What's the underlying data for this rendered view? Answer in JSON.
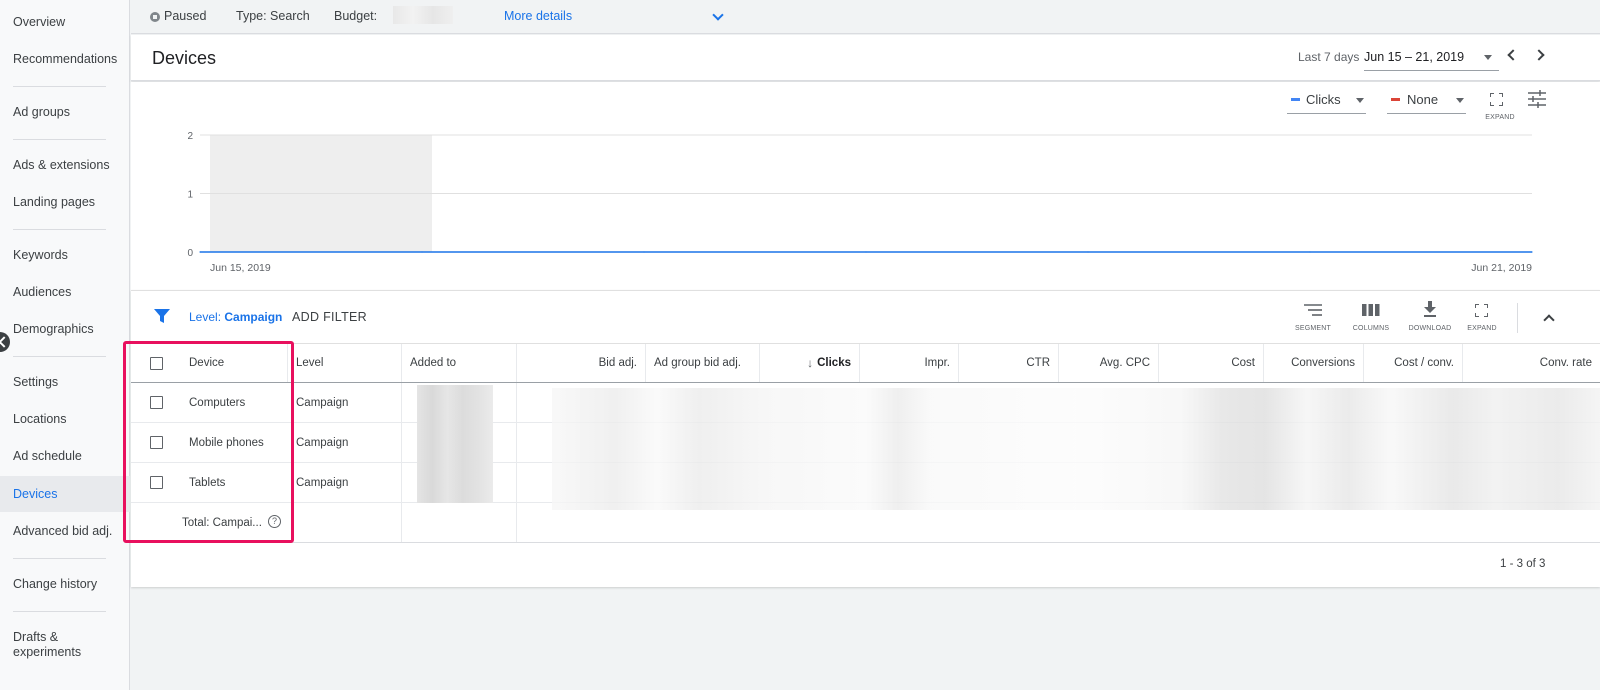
{
  "sidebar": {
    "items": [
      {
        "label": "Overview"
      },
      {
        "label": "Recommendations"
      },
      {
        "label": "Ad groups"
      },
      {
        "label": "Ads & extensions"
      },
      {
        "label": "Landing pages"
      },
      {
        "label": "Keywords"
      },
      {
        "label": "Audiences"
      },
      {
        "label": "Demographics"
      },
      {
        "label": "Settings"
      },
      {
        "label": "Locations"
      },
      {
        "label": "Ad schedule"
      },
      {
        "label": "Devices"
      },
      {
        "label": "Advanced bid adj."
      },
      {
        "label": "Change history"
      },
      {
        "label": "Drafts & experiments"
      }
    ],
    "active": "Devices"
  },
  "topbar": {
    "status": "Paused",
    "type": "Type: Search",
    "budget_label": "Budget:",
    "more_details": "More details"
  },
  "header": {
    "title": "Devices",
    "date_range_label": "Last 7 days",
    "date_range": "Jun 15 – 21, 2019"
  },
  "chart_controls": {
    "metric1": {
      "label": "Clicks",
      "color": "#4285f4"
    },
    "metric2": {
      "label": "None",
      "color": "#db4437"
    },
    "expand_label": "EXPAND"
  },
  "chart_data": {
    "type": "line",
    "x": [
      "Jun 15, 2019",
      "Jun 16, 2019",
      "Jun 17, 2019",
      "Jun 18, 2019",
      "Jun 19, 2019",
      "Jun 20, 2019",
      "Jun 21, 2019"
    ],
    "series": [
      {
        "name": "Clicks",
        "values": [
          0,
          0,
          0,
          0,
          0,
          0,
          0
        ],
        "color": "#1a73e8"
      }
    ],
    "ylim": [
      0,
      2
    ],
    "yticks": [
      0,
      1,
      2
    ],
    "xtick_labels": [
      "Jun 15, 2019",
      "Jun 21, 2019"
    ],
    "grid": true
  },
  "table_toolbar": {
    "level_prefix": "Level:",
    "level_value": "Campaign",
    "add_filter": "ADD FILTER",
    "tools": [
      "SEGMENT",
      "COLUMNS",
      "DOWNLOAD",
      "EXPAND"
    ]
  },
  "table": {
    "columns": [
      "Device",
      "Level",
      "Added to",
      "Bid adj.",
      "Ad group bid adj.",
      "Clicks",
      "Impr.",
      "CTR",
      "Avg. CPC",
      "Cost",
      "Conversions",
      "Cost / conv.",
      "Conv. rate"
    ],
    "sorted_column": "Clicks",
    "rows": [
      {
        "device": "Computers",
        "level": "Campaign"
      },
      {
        "device": "Mobile phones",
        "level": "Campaign"
      },
      {
        "device": "Tablets",
        "level": "Campaign"
      }
    ],
    "total_label": "Total: Campai...",
    "pagination": "1 - 3 of 3"
  },
  "colors": {
    "accent": "#1a73e8",
    "highlight": "#e8105e"
  }
}
